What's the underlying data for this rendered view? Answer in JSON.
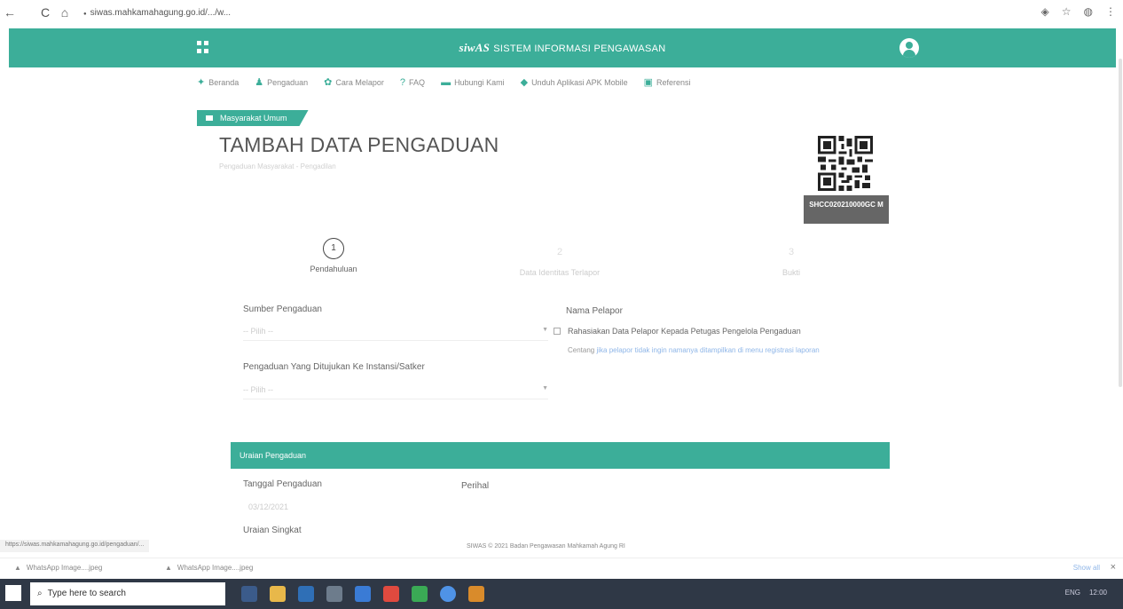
{
  "browser": {
    "url": "siwas.mahkamahagung.go.id/.../w...",
    "back": "←",
    "reload": "C",
    "home": "⌂",
    "lock": "●",
    "right_icons": [
      "◈",
      "☆",
      "◍",
      "⋮"
    ]
  },
  "header": {
    "brand": "siwAS",
    "title": "SISTEM INFORMASI PENGAWASAN"
  },
  "menu": [
    {
      "icon": "home-icon",
      "glyph": "✦",
      "label": "Beranda"
    },
    {
      "icon": "users-icon",
      "glyph": "♟",
      "label": "Pengaduan"
    },
    {
      "icon": "help-icon",
      "glyph": "✿",
      "label": "Cara Melapor"
    },
    {
      "icon": "question-icon",
      "glyph": "?",
      "label": "FAQ"
    },
    {
      "icon": "contact-icon",
      "glyph": "▬",
      "label": "Hubungi Kami"
    },
    {
      "icon": "download-icon",
      "glyph": "◆",
      "label": "Unduh Aplikasi APK Mobile"
    },
    {
      "icon": "book-icon",
      "glyph": "▣",
      "label": "Referensi"
    }
  ],
  "badge": {
    "label": "Masyarakat Umum"
  },
  "page": {
    "title": "TAMBAH DATA PENGADUAN",
    "subtitle": "Pengaduan Masyarakat - Pengadilan"
  },
  "qr": {
    "code": "SHCC020210000GC M"
  },
  "steps": [
    {
      "num": "1",
      "label": "Pendahuluan"
    },
    {
      "num": "2",
      "label": "Data Identitas Terlapor"
    },
    {
      "num": "3",
      "label": "Bukti"
    }
  ],
  "form": {
    "sumber_label": "Sumber Pengaduan",
    "sumber_value": "-- Pilih --",
    "nama_label": "Nama Pelapor",
    "nama_check": "Rahasiakan Data Pelapor Kepada Petugas Pengelola Pengaduan",
    "hint_prefix": "Centang",
    "hint_text": "jika pelapor tidak ingin namanya ditampilkan di menu registrasi laporan",
    "ditujukan_label": "Pengaduan Yang Ditujukan Ke Instansi/Satker",
    "ditujukan_value": "-- Pilih --",
    "section_title": "Uraian Pengaduan",
    "tanggal_label": "Tanggal Pengaduan",
    "tanggal_value": "03/12/2021",
    "perihal_label": "Perihal",
    "uraian_label": "Uraian Singkat"
  },
  "status_url": "https://siwas.mahkamahagung.go.id/pengaduan/...",
  "footer": "SIWAS © 2021 Badan Pengawasan Mahkamah Agung RI",
  "downloads": {
    "items": [
      "WhatsApp Image....jpeg",
      "WhatsApp Image....jpeg"
    ],
    "show_all": "Show all",
    "close": "×"
  },
  "taskbar": {
    "search_placeholder": "Type here to search",
    "tray": [
      "ENG",
      "12:00"
    ]
  },
  "colors": {
    "accent": "#3cae99"
  }
}
